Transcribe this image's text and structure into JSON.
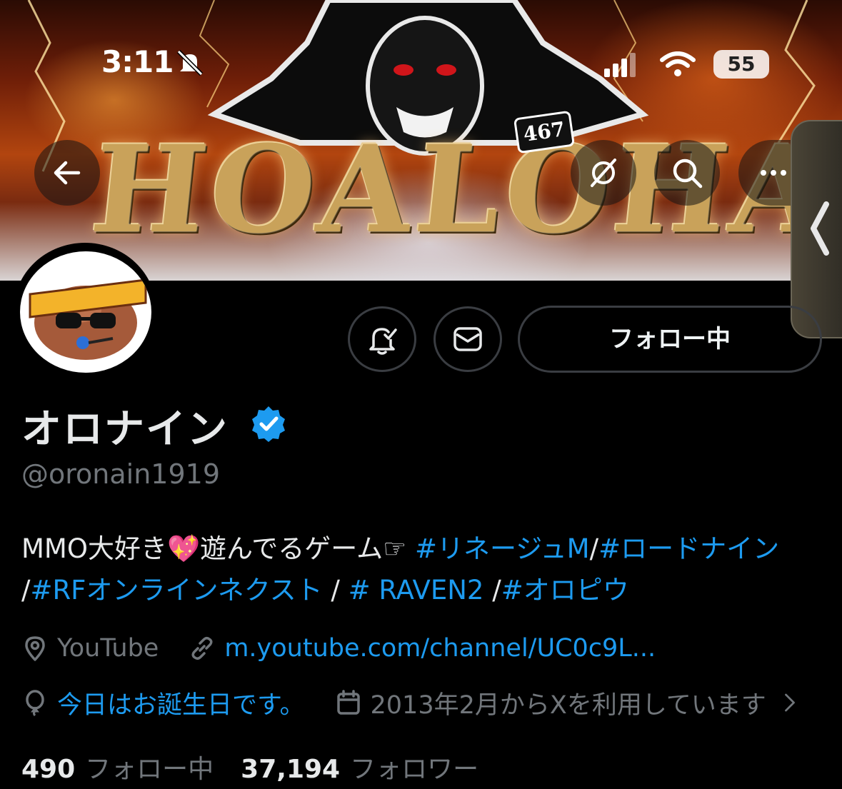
{
  "status_bar": {
    "time": "3:11",
    "battery": "55"
  },
  "banner": {
    "logo_text": "HOALOHA",
    "badge_text": "467"
  },
  "nav": {
    "back": "back-arrow",
    "grok": "grok-icon",
    "search": "search-icon",
    "more": "···"
  },
  "actions": {
    "follow_label": "フォロー中"
  },
  "profile": {
    "display_name": "オロナイン",
    "handle": "@oronain1919",
    "bio": {
      "line1_text": "MMO大好き💖遊んでるゲーム☞ ",
      "tag1": "#リネージュM",
      "sep1": "/",
      "tag2": "#ロードナイン",
      "sep2": " /",
      "tag3": "#RFオンラインネクスト",
      "sep3": " / ",
      "tag4": "# RAVEN2",
      "sep4": " /",
      "tag5": "#オロピウ"
    },
    "location": "YouTube",
    "website": "m.youtube.com/channel/UC0c9L...",
    "birthday": "今日はお誕生日です。",
    "joined": "2013年2月からXを利用しています"
  },
  "stats": {
    "following_count": "490",
    "following_label": "フォロー中",
    "followers_count": "37,194",
    "followers_label": "フォロワー"
  },
  "colors": {
    "accent": "#1d9bf0",
    "muted": "#71767b",
    "text": "#e7e9ea",
    "background": "#000000"
  }
}
